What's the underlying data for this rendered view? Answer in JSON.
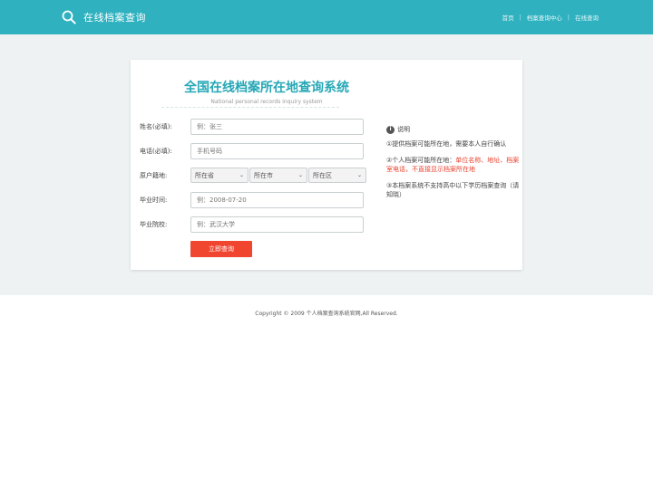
{
  "header": {
    "title": "在线档案查询",
    "nav": [
      "首页",
      "档案查询中心",
      "在线查询"
    ]
  },
  "card": {
    "title_cn": "全国在线档案所在地查询系统",
    "title_en": "National personal records inquiry system"
  },
  "form": {
    "name": {
      "label": "姓名(必填):",
      "placeholder": "例：张三"
    },
    "phone": {
      "label": "电话(必填):",
      "placeholder": "手机号码"
    },
    "origin": {
      "label": "原户籍地:",
      "province": "所在省",
      "city": "所在市",
      "district": "所在区"
    },
    "grad_time": {
      "label": "毕业时间:",
      "placeholder": "例：2008-07-20"
    },
    "school": {
      "label": "毕业院校:",
      "placeholder": "例：武汉大学"
    },
    "submit_label": "立即查询"
  },
  "notes": {
    "heading": "说明",
    "n1": "①提供档案可能所在地，需要本人自行确认",
    "n2_prefix": "②个人档案可能所在地：",
    "n2_red": "单位名称、地址、档案室电话，不直接显示档案所在地",
    "n3": "③本档案系统不支持高中以下学历档案查询（请知晓）"
  },
  "footer": {
    "copyright": "Copyright © 2009 个人档案查询系统官网,All Reserved."
  },
  "colors": {
    "teal": "#2fb1bf",
    "title_teal": "#25a7b6",
    "red": "#f0452f"
  }
}
